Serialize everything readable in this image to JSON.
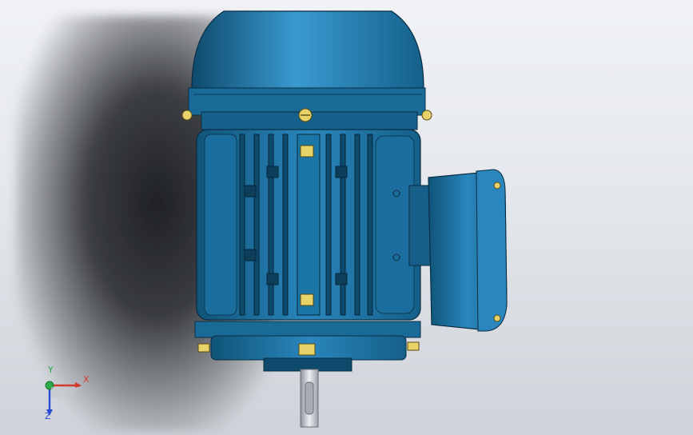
{
  "viewport": {
    "background_top": "#f0f2f6",
    "background_bottom": "#cfd3d9"
  },
  "model": {
    "name": "electric-motor",
    "body_color": "#1c6e9c",
    "dark_color": "#0e4a6c",
    "light_color": "#3a9ad0",
    "bolt_color": "#e8d36a",
    "shaft_color": "#b9bec6"
  },
  "triad": {
    "x_label": "X",
    "y_label": "Y",
    "z_label": "Z",
    "x_color": "#d23a2a",
    "y_color": "#2aa84a",
    "z_color": "#2a4ad2"
  }
}
